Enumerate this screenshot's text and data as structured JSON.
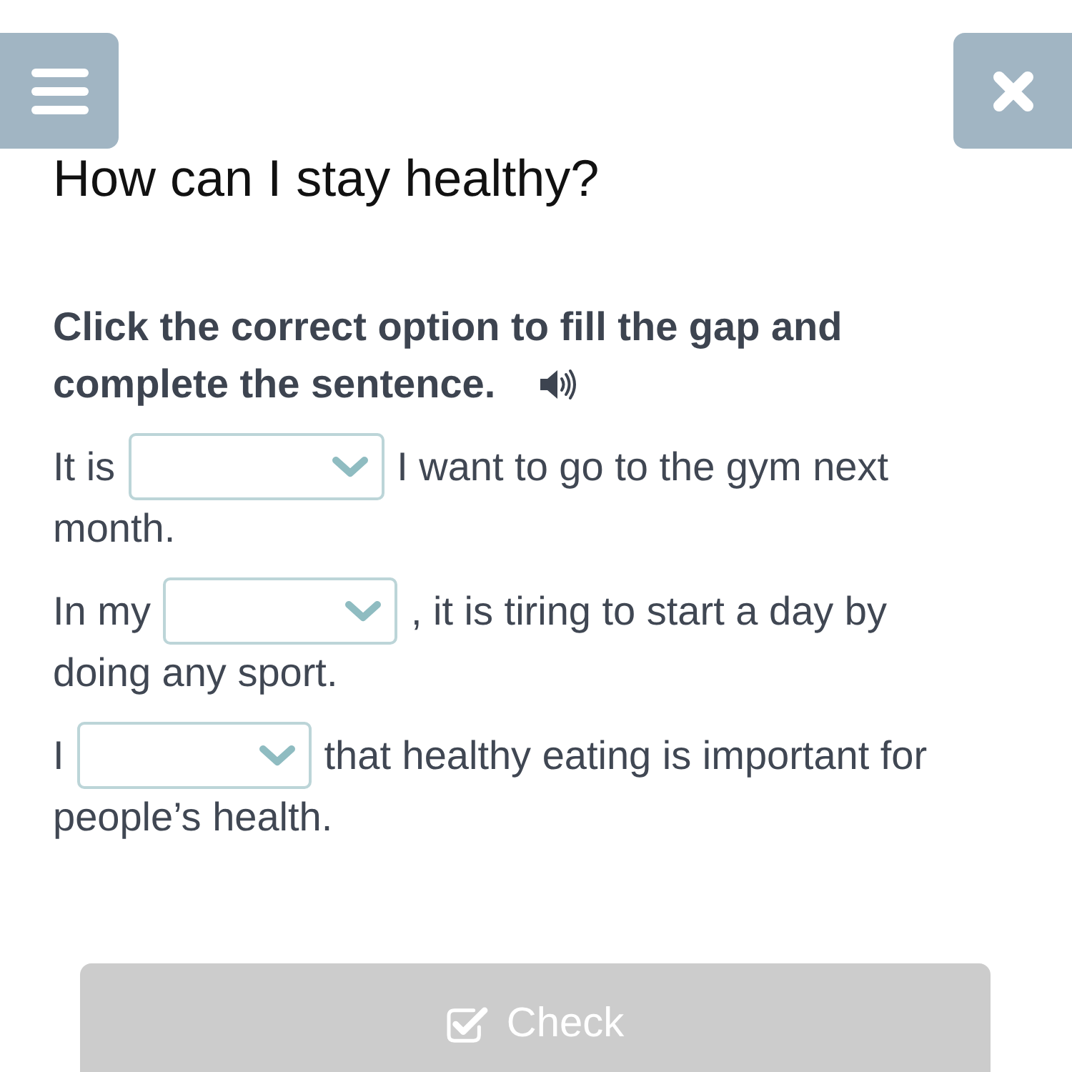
{
  "title": "How can I stay healthy?",
  "instruction": {
    "lines": [
      "Click the correct option to fill the gap and",
      "complete the sentence."
    ]
  },
  "sentences": [
    {
      "lines": [
        {
          "parts": [
            {
              "kind": "text",
              "text": "It is"
            },
            {
              "kind": "dropdown"
            },
            {
              "kind": "text",
              "text": "I want to go to the gym next"
            }
          ]
        },
        {
          "parts": [
            {
              "kind": "text",
              "text": "month."
            }
          ]
        }
      ]
    },
    {
      "lines": [
        {
          "parts": [
            {
              "kind": "text",
              "text": "In my"
            },
            {
              "kind": "dropdown"
            },
            {
              "kind": "text",
              "text": ", it is tiring to start a day by"
            }
          ]
        },
        {
          "parts": [
            {
              "kind": "text",
              "text": "doing any sport."
            }
          ]
        }
      ]
    },
    {
      "lines": [
        {
          "parts": [
            {
              "kind": "text",
              "text": "I"
            },
            {
              "kind": "dropdown"
            },
            {
              "kind": "text",
              "text": "that healthy eating is important for"
            }
          ]
        },
        {
          "parts": [
            {
              "kind": "text",
              "text": "people’s health."
            }
          ]
        }
      ]
    }
  ],
  "check_button": {
    "label": "Check",
    "disabled": true
  }
}
